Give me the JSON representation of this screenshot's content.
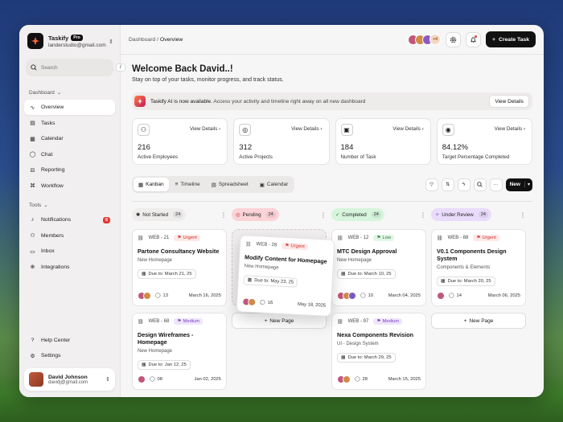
{
  "brand": {
    "name": "Taskify",
    "badge": "Pro",
    "email": "landerstudio@gmail.com"
  },
  "search": {
    "placeholder": "Search",
    "shortcut": "/"
  },
  "dashboard_section": "Dashboard",
  "nav_main": [
    {
      "label": "Overview",
      "icon": "chart-icon",
      "active": true
    },
    {
      "label": "Tasks",
      "icon": "tasks-icon"
    },
    {
      "label": "Calendar",
      "icon": "calendar-icon"
    },
    {
      "label": "Chat",
      "icon": "chat-icon"
    },
    {
      "label": "Reporting",
      "icon": "reporting-icon"
    },
    {
      "label": "Workflow",
      "icon": "workflow-icon"
    }
  ],
  "tools_section": "Tools",
  "nav_tools": [
    {
      "label": "Notifications",
      "icon": "bell-icon",
      "badge": "6"
    },
    {
      "label": "Members",
      "icon": "members-icon"
    },
    {
      "label": "Inbox",
      "icon": "inbox-icon"
    },
    {
      "label": "Integrations",
      "icon": "integrations-icon"
    }
  ],
  "nav_bottom": [
    {
      "label": "Help Center",
      "icon": "help-icon"
    },
    {
      "label": "Settings",
      "icon": "gear-icon"
    }
  ],
  "user": {
    "name": "David Johnson",
    "email": "davidj@gmail.com"
  },
  "breadcrumb": {
    "root": "Dashboard",
    "separator": "/",
    "current": "Overview"
  },
  "header": {
    "avatars_more": "+4",
    "create_label": "Create Task"
  },
  "welcome": {
    "title": "Welcome Back David..!",
    "subtitle": "Stay on top of your tasks, monitor progress, and track status."
  },
  "banner": {
    "strong": "Taskify AI is now available.",
    "text": " Access your activity and timeline right away on all new dashboard",
    "button": "View Details"
  },
  "stats": [
    {
      "value": "216",
      "label": "Active Employees",
      "link": "View Details",
      "icon": "users-icon"
    },
    {
      "value": "312",
      "label": "Active Projects",
      "link": "View Details",
      "icon": "projects-icon"
    },
    {
      "value": "184",
      "label": "Number of Task",
      "link": "View Details",
      "icon": "briefcase-icon"
    },
    {
      "value": "84.12%",
      "label": "Target Percentage Completed",
      "link": "View Details",
      "icon": "target-icon"
    }
  ],
  "views": [
    {
      "label": "Kanban",
      "active": true
    },
    {
      "label": "Timeline"
    },
    {
      "label": "Spreadsheet"
    },
    {
      "label": "Calendar"
    }
  ],
  "new_label": "New",
  "columns": [
    {
      "title": "Not Started",
      "count": "24",
      "color": "#efecec",
      "text": "#222",
      "cards": [
        {
          "id": "WEB - 21",
          "priority": "Urgent",
          "ptype": "urgent",
          "title": "Partone Consultancy Website",
          "sub": "New Homepage",
          "due": "Due to: March 21, 25",
          "comments": "13",
          "date": "March 16, 2025",
          "avatars": 2
        },
        {
          "id": "WEB - 68",
          "priority": "Medium",
          "ptype": "medium",
          "title": "Design Wireframes - Homepage",
          "sub": "New Homepage",
          "due": "Due to: Jan 12, 25",
          "comments": "08",
          "date": "Jan 02, 2025",
          "avatars": 1
        }
      ]
    },
    {
      "title": "Pending",
      "count": "24",
      "color": "#fcd3d7",
      "text": "#b3202e",
      "floating": {
        "id": "WEB - 28",
        "priority": "Urgent",
        "ptype": "urgent",
        "title": "Modify Content for Homepage",
        "sub": "New Homepage",
        "due": "Due to: May 23, 25",
        "comments": "16",
        "date": "May 18, 2025",
        "avatars": 2
      },
      "new_page": "New Page"
    },
    {
      "title": "Completed",
      "count": "24",
      "color": "#d6f5dc",
      "text": "#237a35",
      "cards": [
        {
          "id": "WEB - 12",
          "priority": "Low",
          "ptype": "low",
          "title": "MTC Design Approval",
          "sub": "New Homepage",
          "due": "Due to: March 10, 25",
          "comments": "10",
          "date": "March 04, 2025",
          "avatars": 3
        },
        {
          "id": "WEB - 97",
          "priority": "Medium",
          "ptype": "medium",
          "title": "Nexa Components Revision",
          "sub": "UI - Design System",
          "due": "Due to: March 29, 25",
          "comments": "28",
          "date": "March 15, 2025",
          "avatars": 2
        }
      ]
    },
    {
      "title": "Under Review",
      "count": "24",
      "color": "#e9dcfb",
      "text": "#6a2fb8",
      "cards": [
        {
          "id": "WEB - 88",
          "priority": "Urgent",
          "ptype": "urgent",
          "title": "V0.1 Components Design System",
          "sub": "Components & Elements",
          "due": "Due to: March 20, 25",
          "comments": "14",
          "date": "March 06, 2025",
          "avatars": 1
        }
      ],
      "new_page": "New Page"
    }
  ]
}
